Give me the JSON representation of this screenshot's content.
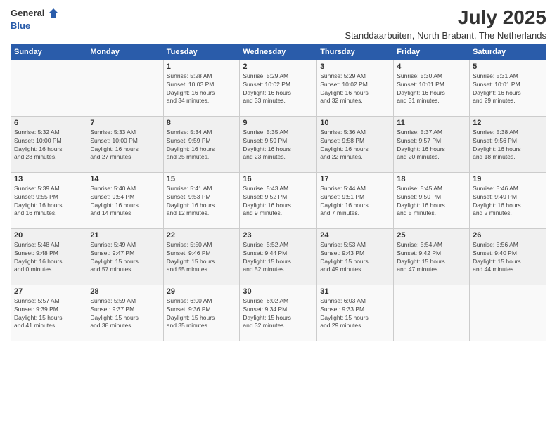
{
  "header": {
    "logo_line1": "General",
    "logo_line2": "Blue",
    "month_year": "July 2025",
    "location": "Standdaarbuiten, North Brabant, The Netherlands"
  },
  "weekdays": [
    "Sunday",
    "Monday",
    "Tuesday",
    "Wednesday",
    "Thursday",
    "Friday",
    "Saturday"
  ],
  "weeks": [
    [
      {
        "day": "",
        "info": ""
      },
      {
        "day": "",
        "info": ""
      },
      {
        "day": "1",
        "info": "Sunrise: 5:28 AM\nSunset: 10:03 PM\nDaylight: 16 hours\nand 34 minutes."
      },
      {
        "day": "2",
        "info": "Sunrise: 5:29 AM\nSunset: 10:02 PM\nDaylight: 16 hours\nand 33 minutes."
      },
      {
        "day": "3",
        "info": "Sunrise: 5:29 AM\nSunset: 10:02 PM\nDaylight: 16 hours\nand 32 minutes."
      },
      {
        "day": "4",
        "info": "Sunrise: 5:30 AM\nSunset: 10:01 PM\nDaylight: 16 hours\nand 31 minutes."
      },
      {
        "day": "5",
        "info": "Sunrise: 5:31 AM\nSunset: 10:01 PM\nDaylight: 16 hours\nand 29 minutes."
      }
    ],
    [
      {
        "day": "6",
        "info": "Sunrise: 5:32 AM\nSunset: 10:00 PM\nDaylight: 16 hours\nand 28 minutes."
      },
      {
        "day": "7",
        "info": "Sunrise: 5:33 AM\nSunset: 10:00 PM\nDaylight: 16 hours\nand 27 minutes."
      },
      {
        "day": "8",
        "info": "Sunrise: 5:34 AM\nSunset: 9:59 PM\nDaylight: 16 hours\nand 25 minutes."
      },
      {
        "day": "9",
        "info": "Sunrise: 5:35 AM\nSunset: 9:59 PM\nDaylight: 16 hours\nand 23 minutes."
      },
      {
        "day": "10",
        "info": "Sunrise: 5:36 AM\nSunset: 9:58 PM\nDaylight: 16 hours\nand 22 minutes."
      },
      {
        "day": "11",
        "info": "Sunrise: 5:37 AM\nSunset: 9:57 PM\nDaylight: 16 hours\nand 20 minutes."
      },
      {
        "day": "12",
        "info": "Sunrise: 5:38 AM\nSunset: 9:56 PM\nDaylight: 16 hours\nand 18 minutes."
      }
    ],
    [
      {
        "day": "13",
        "info": "Sunrise: 5:39 AM\nSunset: 9:55 PM\nDaylight: 16 hours\nand 16 minutes."
      },
      {
        "day": "14",
        "info": "Sunrise: 5:40 AM\nSunset: 9:54 PM\nDaylight: 16 hours\nand 14 minutes."
      },
      {
        "day": "15",
        "info": "Sunrise: 5:41 AM\nSunset: 9:53 PM\nDaylight: 16 hours\nand 12 minutes."
      },
      {
        "day": "16",
        "info": "Sunrise: 5:43 AM\nSunset: 9:52 PM\nDaylight: 16 hours\nand 9 minutes."
      },
      {
        "day": "17",
        "info": "Sunrise: 5:44 AM\nSunset: 9:51 PM\nDaylight: 16 hours\nand 7 minutes."
      },
      {
        "day": "18",
        "info": "Sunrise: 5:45 AM\nSunset: 9:50 PM\nDaylight: 16 hours\nand 5 minutes."
      },
      {
        "day": "19",
        "info": "Sunrise: 5:46 AM\nSunset: 9:49 PM\nDaylight: 16 hours\nand 2 minutes."
      }
    ],
    [
      {
        "day": "20",
        "info": "Sunrise: 5:48 AM\nSunset: 9:48 PM\nDaylight: 16 hours\nand 0 minutes."
      },
      {
        "day": "21",
        "info": "Sunrise: 5:49 AM\nSunset: 9:47 PM\nDaylight: 15 hours\nand 57 minutes."
      },
      {
        "day": "22",
        "info": "Sunrise: 5:50 AM\nSunset: 9:46 PM\nDaylight: 15 hours\nand 55 minutes."
      },
      {
        "day": "23",
        "info": "Sunrise: 5:52 AM\nSunset: 9:44 PM\nDaylight: 15 hours\nand 52 minutes."
      },
      {
        "day": "24",
        "info": "Sunrise: 5:53 AM\nSunset: 9:43 PM\nDaylight: 15 hours\nand 49 minutes."
      },
      {
        "day": "25",
        "info": "Sunrise: 5:54 AM\nSunset: 9:42 PM\nDaylight: 15 hours\nand 47 minutes."
      },
      {
        "day": "26",
        "info": "Sunrise: 5:56 AM\nSunset: 9:40 PM\nDaylight: 15 hours\nand 44 minutes."
      }
    ],
    [
      {
        "day": "27",
        "info": "Sunrise: 5:57 AM\nSunset: 9:39 PM\nDaylight: 15 hours\nand 41 minutes."
      },
      {
        "day": "28",
        "info": "Sunrise: 5:59 AM\nSunset: 9:37 PM\nDaylight: 15 hours\nand 38 minutes."
      },
      {
        "day": "29",
        "info": "Sunrise: 6:00 AM\nSunset: 9:36 PM\nDaylight: 15 hours\nand 35 minutes."
      },
      {
        "day": "30",
        "info": "Sunrise: 6:02 AM\nSunset: 9:34 PM\nDaylight: 15 hours\nand 32 minutes."
      },
      {
        "day": "31",
        "info": "Sunrise: 6:03 AM\nSunset: 9:33 PM\nDaylight: 15 hours\nand 29 minutes."
      },
      {
        "day": "",
        "info": ""
      },
      {
        "day": "",
        "info": ""
      }
    ]
  ]
}
